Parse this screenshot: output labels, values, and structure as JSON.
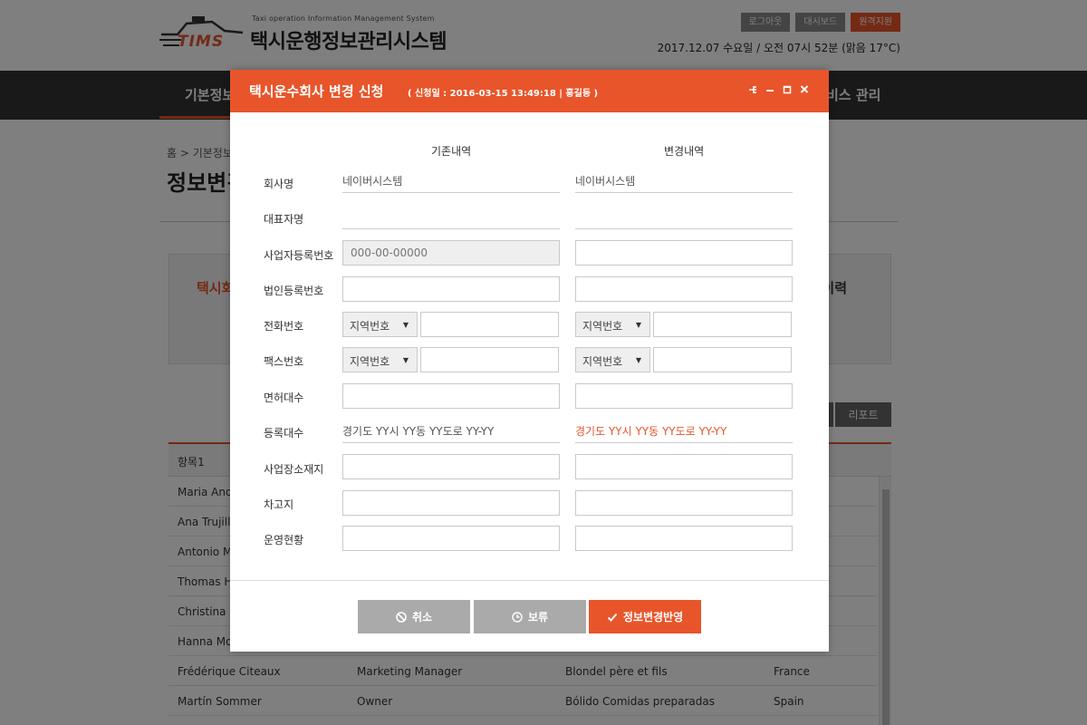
{
  "header": {
    "logo_subtitle": "Taxi operation Information Management System",
    "logo_title": "택시운행정보관리시스템",
    "logo_brand": "TIMS",
    "buttons": [
      "로그아웃",
      "대시보드",
      "원격지원"
    ],
    "datetime": "2017.12.07 수요일 / 오전 07시 52분 (맑음 17°C)"
  },
  "nav": {
    "items": [
      "기본정보",
      "비스 관리"
    ]
  },
  "breadcrumb": "홈 > 기본정보",
  "page_title": "정보변경",
  "info_box": {
    "left_text": "택시회",
    "right_text": "이력"
  },
  "report_button": "리포트",
  "grid": {
    "header": "항목1",
    "rows": [
      [
        "Maria Ande",
        "",
        "",
        ""
      ],
      [
        "Ana Trujillo",
        "",
        "",
        ""
      ],
      [
        "Antonio Mo",
        "",
        "",
        ""
      ],
      [
        "Thomas H",
        "",
        "",
        ""
      ],
      [
        "Christina B",
        "",
        "",
        ""
      ],
      [
        "Hanna Mo",
        "",
        "",
        ""
      ],
      [
        "Frédérique Citeaux",
        "Marketing Manager",
        "Blondel père et fils",
        "France"
      ],
      [
        "Martín Sommer",
        "Owner",
        "Bólido Comidas preparadas",
        "Spain"
      ]
    ]
  },
  "modal": {
    "title": "택시운수회사 변경 신청",
    "meta": "( 신청일 : 2016-03-15 13:49:18 | 홍길동 )",
    "controls": [
      "pin-icon",
      "minimize-icon",
      "maximize-icon",
      "close-icon"
    ],
    "col_existing": "기존내역",
    "col_changed": "변경내역",
    "labels": {
      "company": "회사명",
      "ceo": "대표자명",
      "biz_reg": "사업자등록번호",
      "corp_reg": "법인등록번호",
      "phone": "전화번호",
      "fax": "팩스번호",
      "license_count": "면허대수",
      "registered_count": "등록대수",
      "biz_address": "사업장소재지",
      "garage": "차고지",
      "operation": "운영현황"
    },
    "existing": {
      "company": "네이버시스템",
      "ceo": "",
      "biz_reg_placeholder": "000-00-00000",
      "area_code": "지역번호",
      "fax_area_code": "지역번호",
      "registered_count": "경기도 YY시 YY동 YY도로 YY-YY"
    },
    "changed": {
      "company": "네이버시스템",
      "ceo": "",
      "area_code": "지역번호",
      "fax_area_code": "지역번호",
      "registered_count": "경기도 YY시 YY동 YY도로 YY-YY"
    },
    "buttons": {
      "cancel": "취소",
      "hold": "보류",
      "apply": "정보변경반영"
    }
  }
}
